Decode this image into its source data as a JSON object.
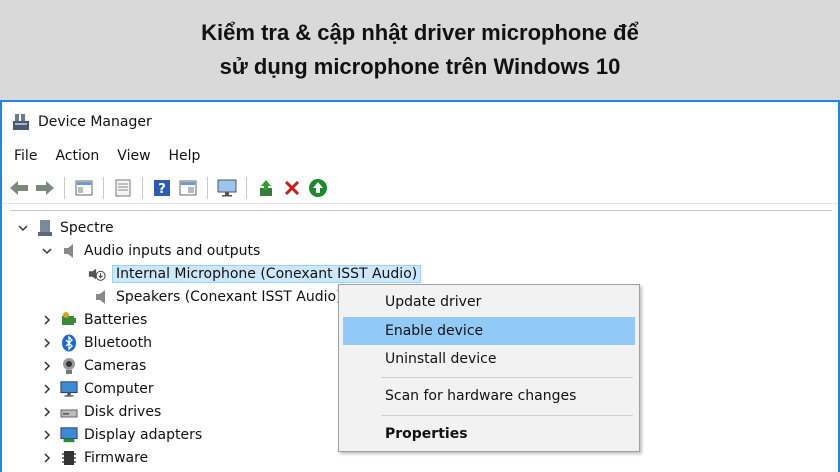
{
  "banner": {
    "line1": "Kiểm tra & cập nhật driver microphone để",
    "line2": "sử dụng microphone trên Windows 10"
  },
  "window": {
    "title": "Device Manager",
    "menu": [
      "File",
      "Action",
      "View",
      "Help"
    ]
  },
  "toolbar": {
    "icons": [
      "back-arrow-icon",
      "forward-arrow-icon",
      "show-hide-tree-icon",
      "properties-icon",
      "help-icon",
      "view-icon",
      "monitor-icon",
      "update-driver-icon",
      "uninstall-icon",
      "scan-hardware-icon"
    ]
  },
  "tree": {
    "root": "Spectre",
    "audio": "Audio inputs and outputs",
    "mic": "Internal Microphone (Conexant ISST Audio)",
    "speakers": "Speakers (Conexant ISST Audio)",
    "batteries": "Batteries",
    "bluetooth": "Bluetooth",
    "cameras": "Cameras",
    "computer": "Computer",
    "disk_drives": "Disk drives",
    "display_adapters": "Display adapters",
    "firmware": "Firmware"
  },
  "context_menu": {
    "update": "Update driver",
    "enable": "Enable device",
    "uninstall": "Uninstall device",
    "scan": "Scan for hardware changes",
    "properties": "Properties"
  },
  "colors": {
    "accent": "#1e88e5",
    "highlight": "#91c9f7"
  }
}
